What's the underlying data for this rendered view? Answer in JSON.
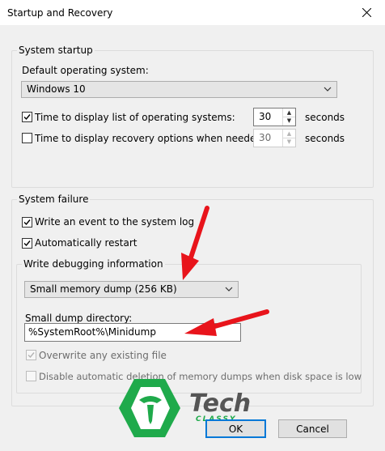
{
  "window": {
    "title": "Startup and Recovery"
  },
  "system_startup": {
    "legend": "System startup",
    "default_os_label": "Default operating system:",
    "default_os_value": "Windows 10",
    "time_list_label": "Time to display list of operating systems:",
    "time_list_checked": true,
    "time_list_value": "30",
    "time_recovery_label": "Time to display recovery options when needed:",
    "time_recovery_checked": false,
    "time_recovery_value": "30",
    "seconds": "seconds"
  },
  "system_failure": {
    "legend": "System failure",
    "write_event_label": "Write an event to the system log",
    "auto_restart_label": "Automatically restart",
    "debug": {
      "legend": "Write debugging information",
      "dump_type": "Small memory dump (256 KB)",
      "dir_label": "Small dump directory:",
      "dir_value": "%SystemRoot%\\Minidump",
      "overwrite_label": "Overwrite any existing file",
      "disable_auto_delete_label": "Disable automatic deletion of memory dumps when disk space is low"
    }
  },
  "buttons": {
    "ok": "OK",
    "cancel": "Cancel"
  },
  "watermark": {
    "text": "Tech",
    "subtext": "CLASSY"
  },
  "colors": {
    "accent": "#0078d7",
    "arrow": "#e8141b",
    "logo_green": "#1faa4b"
  }
}
